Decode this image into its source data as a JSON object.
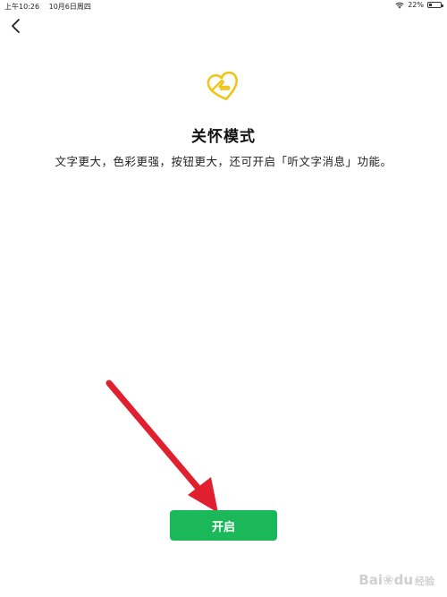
{
  "status_bar": {
    "time": "上午10:26",
    "date": "10月6日周四",
    "battery": "22%",
    "battery_level": 0.22,
    "icons": [
      "wifi-icon",
      "battery-icon"
    ]
  },
  "nav": {
    "back_icon": "chevron-left-icon"
  },
  "main": {
    "icon": "care-mode-heart-hand-icon",
    "icon_color": "#f0c419",
    "title": "关怀模式",
    "description": "文字更大，色彩更强，按钮更大，还可开启「听文字消息」功能。"
  },
  "action": {
    "enable_label": "开启",
    "enable_color": "#1bb85a"
  },
  "annotation": {
    "arrow_color": "#e0202e"
  },
  "watermark": {
    "text_a": "Bai",
    "text_b": "du",
    "text_c": "经验"
  }
}
